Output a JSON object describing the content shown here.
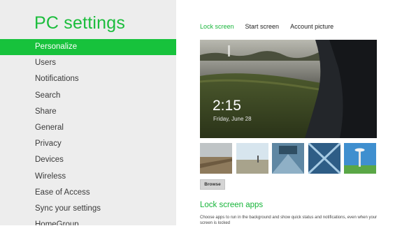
{
  "app": {
    "title": "PC settings"
  },
  "sidebar": {
    "items": [
      {
        "label": "Personalize",
        "selected": true
      },
      {
        "label": "Users"
      },
      {
        "label": "Notifications"
      },
      {
        "label": "Search"
      },
      {
        "label": "Share"
      },
      {
        "label": "General"
      },
      {
        "label": "Privacy"
      },
      {
        "label": "Devices"
      },
      {
        "label": "Wireless"
      },
      {
        "label": "Ease of Access"
      },
      {
        "label": "Sync your settings"
      },
      {
        "label": "HomeGroup"
      }
    ]
  },
  "main": {
    "tabs": [
      {
        "label": "Lock screen",
        "active": true
      },
      {
        "label": "Start screen"
      },
      {
        "label": "Account picture"
      }
    ],
    "preview": {
      "time": "2:15",
      "date": "Friday, June 28"
    },
    "browse_label": "Browse",
    "lock_apps": {
      "title": "Lock screen apps",
      "description": "Choose apps to run in the background and show quick status and notifications, even when your screen is locked"
    }
  },
  "colors": {
    "accent": "#17c23c",
    "sidebar_bg": "#ededed"
  }
}
